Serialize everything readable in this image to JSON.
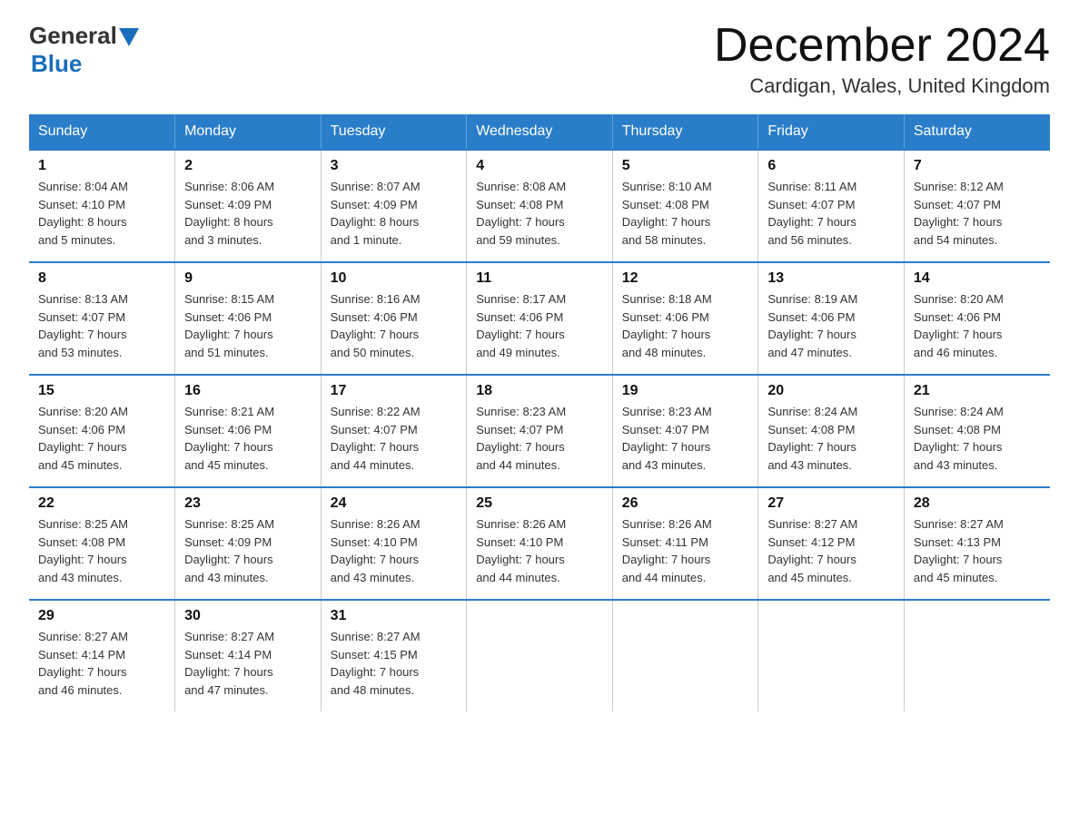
{
  "header": {
    "logo_general": "General",
    "logo_blue": "Blue",
    "month_title": "December 2024",
    "location": "Cardigan, Wales, United Kingdom"
  },
  "weekdays": [
    "Sunday",
    "Monday",
    "Tuesday",
    "Wednesday",
    "Thursday",
    "Friday",
    "Saturday"
  ],
  "weeks": [
    [
      {
        "day": "1",
        "info": "Sunrise: 8:04 AM\nSunset: 4:10 PM\nDaylight: 8 hours\nand 5 minutes."
      },
      {
        "day": "2",
        "info": "Sunrise: 8:06 AM\nSunset: 4:09 PM\nDaylight: 8 hours\nand 3 minutes."
      },
      {
        "day": "3",
        "info": "Sunrise: 8:07 AM\nSunset: 4:09 PM\nDaylight: 8 hours\nand 1 minute."
      },
      {
        "day": "4",
        "info": "Sunrise: 8:08 AM\nSunset: 4:08 PM\nDaylight: 7 hours\nand 59 minutes."
      },
      {
        "day": "5",
        "info": "Sunrise: 8:10 AM\nSunset: 4:08 PM\nDaylight: 7 hours\nand 58 minutes."
      },
      {
        "day": "6",
        "info": "Sunrise: 8:11 AM\nSunset: 4:07 PM\nDaylight: 7 hours\nand 56 minutes."
      },
      {
        "day": "7",
        "info": "Sunrise: 8:12 AM\nSunset: 4:07 PM\nDaylight: 7 hours\nand 54 minutes."
      }
    ],
    [
      {
        "day": "8",
        "info": "Sunrise: 8:13 AM\nSunset: 4:07 PM\nDaylight: 7 hours\nand 53 minutes."
      },
      {
        "day": "9",
        "info": "Sunrise: 8:15 AM\nSunset: 4:06 PM\nDaylight: 7 hours\nand 51 minutes."
      },
      {
        "day": "10",
        "info": "Sunrise: 8:16 AM\nSunset: 4:06 PM\nDaylight: 7 hours\nand 50 minutes."
      },
      {
        "day": "11",
        "info": "Sunrise: 8:17 AM\nSunset: 4:06 PM\nDaylight: 7 hours\nand 49 minutes."
      },
      {
        "day": "12",
        "info": "Sunrise: 8:18 AM\nSunset: 4:06 PM\nDaylight: 7 hours\nand 48 minutes."
      },
      {
        "day": "13",
        "info": "Sunrise: 8:19 AM\nSunset: 4:06 PM\nDaylight: 7 hours\nand 47 minutes."
      },
      {
        "day": "14",
        "info": "Sunrise: 8:20 AM\nSunset: 4:06 PM\nDaylight: 7 hours\nand 46 minutes."
      }
    ],
    [
      {
        "day": "15",
        "info": "Sunrise: 8:20 AM\nSunset: 4:06 PM\nDaylight: 7 hours\nand 45 minutes."
      },
      {
        "day": "16",
        "info": "Sunrise: 8:21 AM\nSunset: 4:06 PM\nDaylight: 7 hours\nand 45 minutes."
      },
      {
        "day": "17",
        "info": "Sunrise: 8:22 AM\nSunset: 4:07 PM\nDaylight: 7 hours\nand 44 minutes."
      },
      {
        "day": "18",
        "info": "Sunrise: 8:23 AM\nSunset: 4:07 PM\nDaylight: 7 hours\nand 44 minutes."
      },
      {
        "day": "19",
        "info": "Sunrise: 8:23 AM\nSunset: 4:07 PM\nDaylight: 7 hours\nand 43 minutes."
      },
      {
        "day": "20",
        "info": "Sunrise: 8:24 AM\nSunset: 4:08 PM\nDaylight: 7 hours\nand 43 minutes."
      },
      {
        "day": "21",
        "info": "Sunrise: 8:24 AM\nSunset: 4:08 PM\nDaylight: 7 hours\nand 43 minutes."
      }
    ],
    [
      {
        "day": "22",
        "info": "Sunrise: 8:25 AM\nSunset: 4:08 PM\nDaylight: 7 hours\nand 43 minutes."
      },
      {
        "day": "23",
        "info": "Sunrise: 8:25 AM\nSunset: 4:09 PM\nDaylight: 7 hours\nand 43 minutes."
      },
      {
        "day": "24",
        "info": "Sunrise: 8:26 AM\nSunset: 4:10 PM\nDaylight: 7 hours\nand 43 minutes."
      },
      {
        "day": "25",
        "info": "Sunrise: 8:26 AM\nSunset: 4:10 PM\nDaylight: 7 hours\nand 44 minutes."
      },
      {
        "day": "26",
        "info": "Sunrise: 8:26 AM\nSunset: 4:11 PM\nDaylight: 7 hours\nand 44 minutes."
      },
      {
        "day": "27",
        "info": "Sunrise: 8:27 AM\nSunset: 4:12 PM\nDaylight: 7 hours\nand 45 minutes."
      },
      {
        "day": "28",
        "info": "Sunrise: 8:27 AM\nSunset: 4:13 PM\nDaylight: 7 hours\nand 45 minutes."
      }
    ],
    [
      {
        "day": "29",
        "info": "Sunrise: 8:27 AM\nSunset: 4:14 PM\nDaylight: 7 hours\nand 46 minutes."
      },
      {
        "day": "30",
        "info": "Sunrise: 8:27 AM\nSunset: 4:14 PM\nDaylight: 7 hours\nand 47 minutes."
      },
      {
        "day": "31",
        "info": "Sunrise: 8:27 AM\nSunset: 4:15 PM\nDaylight: 7 hours\nand 48 minutes."
      },
      {
        "day": "",
        "info": ""
      },
      {
        "day": "",
        "info": ""
      },
      {
        "day": "",
        "info": ""
      },
      {
        "day": "",
        "info": ""
      }
    ]
  ]
}
